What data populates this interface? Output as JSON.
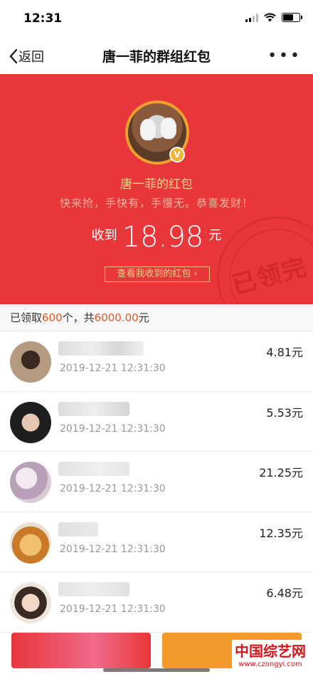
{
  "status": {
    "time": "12:31"
  },
  "nav": {
    "back_label": "返回",
    "title": "唐一菲的群组红包",
    "more_label": "•••"
  },
  "packet": {
    "sender": "唐一菲的红包",
    "greeting": "快来抢，手快有，手慢无。恭喜发财！",
    "received_prefix": "收到",
    "amount": "18.98",
    "amount_unit": "元",
    "view_link": "查看我收到的红包 ›",
    "stamp_text": "已领完",
    "badge": "V"
  },
  "summary": {
    "prefix": "已领取",
    "count": "600",
    "middle": "个，共",
    "total": "6000.00",
    "unit": "元"
  },
  "records": [
    {
      "time": "2019-12-21 12:31:30",
      "amount": "4.81元",
      "avatar_color": "#8a6a50"
    },
    {
      "time": "2019-12-21 12:31:30",
      "amount": "5.53元",
      "avatar_color": "#2a2a2a"
    },
    {
      "time": "2019-12-21 12:31:30",
      "amount": "21.25元",
      "avatar_color": "#c9b6c8"
    },
    {
      "time": "2019-12-21 12:31:30",
      "amount": "12.35元",
      "avatar_color": "#d8963a"
    },
    {
      "time": "2019-12-21 12:31:30",
      "amount": "6.48元",
      "avatar_color": "#e9d9cc"
    }
  ],
  "watermark": {
    "title": "中国综艺网",
    "url": "www.czongyi.com"
  },
  "colors": {
    "red": "#e8363a",
    "gold": "#f7d58a",
    "orange": "#f39a2b",
    "highlight": "#e05a2b"
  }
}
